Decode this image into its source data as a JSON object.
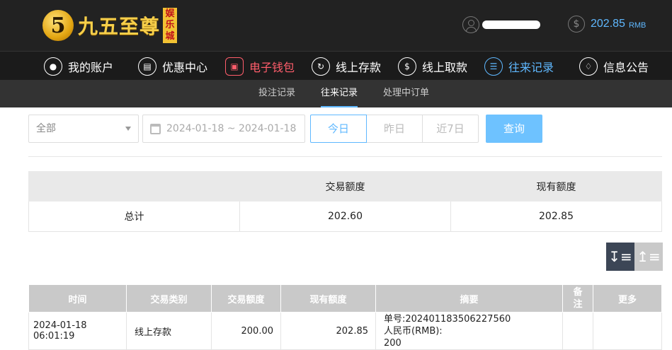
{
  "header": {
    "logo_mark": "5",
    "logo_text": "九五至尊",
    "logo_sub": "娱乐城",
    "balance_value": "202.85",
    "balance_unit": "RMB"
  },
  "mainnav": [
    {
      "label": "我的账户",
      "icon": "user-circle-icon"
    },
    {
      "label": "优惠中心",
      "icon": "gift-icon"
    },
    {
      "label": "电子钱包",
      "icon": "wallet-icon"
    },
    {
      "label": "线上存款",
      "icon": "deposit-icon"
    },
    {
      "label": "线上取款",
      "icon": "withdraw-icon"
    },
    {
      "label": "往来记录",
      "icon": "records-icon"
    },
    {
      "label": "信息公告",
      "icon": "bell-icon"
    }
  ],
  "subnav": [
    {
      "label": "投注记录"
    },
    {
      "label": "往来记录"
    },
    {
      "label": "处理中订单"
    }
  ],
  "filter": {
    "type_value": "全部",
    "date_range": "2024-01-18 ~ 2024-01-18",
    "btn_today": "今日",
    "btn_yesterday": "昨日",
    "btn_week": "近7日",
    "btn_query": "查询"
  },
  "summary": {
    "headers": [
      "",
      "交易额度",
      "现有额度"
    ],
    "row": [
      "总计",
      "202.60",
      "202.85"
    ]
  },
  "detail": {
    "headers": [
      "时间",
      "交易类别",
      "交易额度",
      "现有额度",
      "摘要",
      "备注",
      "更多"
    ],
    "rows": [
      {
        "time": "2024-01-18 06:01:19",
        "type": "线上存款",
        "amount": "200.00",
        "balance": "202.85",
        "memo_1": "单号:202401183506227560",
        "memo_2": "人民币(RMB):",
        "memo_3": "200",
        "note": "",
        "more": ""
      }
    ]
  },
  "colors": {
    "accent_blue": "#5fb8ff",
    "accent_red": "#ff5d6b",
    "topbar": "#222222"
  }
}
